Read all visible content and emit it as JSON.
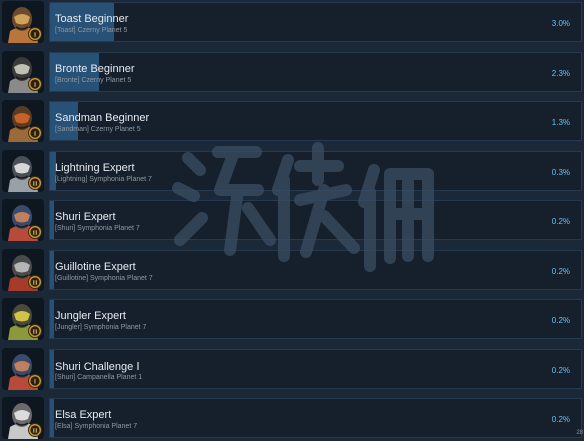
{
  "achievements": [
    {
      "title": "Toast Beginner",
      "sub": "[Toast] Czerny Planet 5",
      "percent": "3.0%",
      "fill": 0.03,
      "rank": "I",
      "hue": "#b8763a",
      "helmet": "#6b4a2e",
      "visor": "#e0b060"
    },
    {
      "title": "Bronte Beginner",
      "sub": "[Bronte] Czerny Planet 5",
      "percent": "2.3%",
      "fill": 0.023,
      "rank": "I",
      "hue": "#8a8a8a",
      "helmet": "#3a3a3a",
      "visor": "#d8d8c8"
    },
    {
      "title": "Sandman Beginner",
      "sub": "[Sandman] Czerny Planet 5",
      "percent": "1.3%",
      "fill": 0.013,
      "rank": "I",
      "hue": "#9a6a3a",
      "helmet": "#5a3a22",
      "visor": "#d86a2a"
    },
    {
      "title": "Lightning Expert",
      "sub": "[Lightning] Symphonia Planet 7",
      "percent": "0.3%",
      "fill": 0.003,
      "rank": "II",
      "hue": "#9aa0a8",
      "helmet": "#4a4e56",
      "visor": "#f0f0f0"
    },
    {
      "title": "Shuri Expert",
      "sub": "[Shuri] Symphonia Planet 7",
      "percent": "0.2%",
      "fill": 0.002,
      "rank": "II",
      "hue": "#b84a3a",
      "helmet": "#3a4a6a",
      "visor": "#d88a5a"
    },
    {
      "title": "Guillotine Expert",
      "sub": "[Guillotine] Symphonia Planet 7",
      "percent": "0.2%",
      "fill": 0.002,
      "rank": "II",
      "hue": "#a83a2a",
      "helmet": "#4a4a4a",
      "visor": "#c8c8c8"
    },
    {
      "title": "Jungler Expert",
      "sub": "[Jungler] Symphonia Planet 7",
      "percent": "0.2%",
      "fill": 0.002,
      "rank": "II",
      "hue": "#8a9a3a",
      "helmet": "#4a4a3a",
      "visor": "#e8d84a"
    },
    {
      "title": "Shuri Challenge Ⅰ",
      "sub": "[Shuri] Campanella Planet 1",
      "percent": "0.2%",
      "fill": 0.002,
      "rank": "Ⅰ",
      "hue": "#b84a3a",
      "helmet": "#3a4a6a",
      "visor": "#d88a5a"
    },
    {
      "title": "Elsa Expert",
      "sub": "[Elsa] Symphonia Planet 7",
      "percent": "0.2%",
      "fill": 0.002,
      "rank": "II",
      "hue": "#c8c8c8",
      "helmet": "#6a6a6a",
      "visor": "#f0f0f0"
    }
  ],
  "watermark": "游侠网",
  "corner_text": "28"
}
